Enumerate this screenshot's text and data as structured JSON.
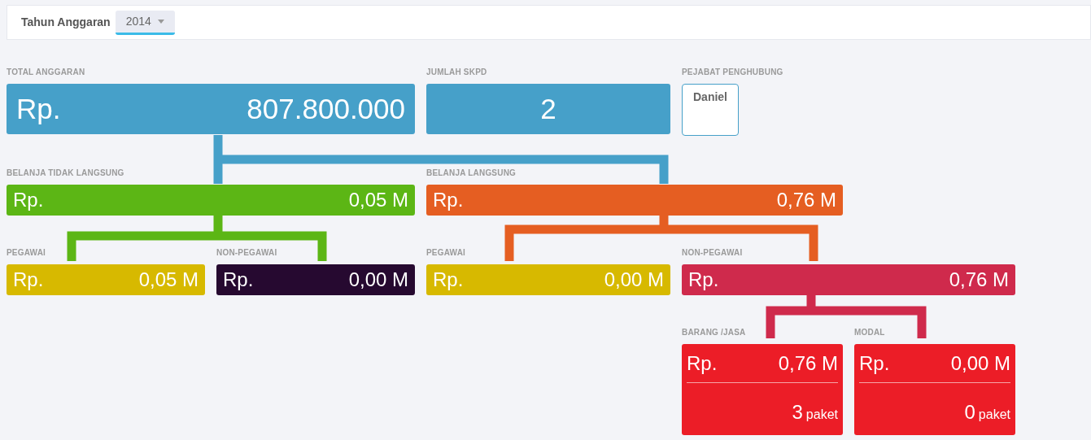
{
  "filter": {
    "label": "Tahun Anggaran",
    "year": "2014"
  },
  "nodes": [
    {
      "kind": "total",
      "label": "TOTAL ANGGARAN",
      "currency": "Rp.",
      "value": "807.800.000",
      "color": "#46a0c9"
    },
    {
      "kind": "count",
      "label": "JUMLAH SKPD",
      "value": "2",
      "color": "#46a0c9"
    },
    {
      "kind": "person",
      "label": "PEJABAT PENGHUBUNG",
      "value": "Daniel",
      "color": "#46a0c9"
    },
    {
      "kind": "amount",
      "label": "BELANJA TIDAK LANGSUNG",
      "currency": "Rp.",
      "value": "0,05 M",
      "color": "#5cb615"
    },
    {
      "kind": "amount",
      "label": "BELANJA LANGSUNG",
      "currency": "Rp.",
      "value": "0,76 M",
      "color": "#e55e22"
    },
    {
      "kind": "amount",
      "label": "PEGAWAI",
      "currency": "Rp.",
      "value": "0,05 M",
      "color": "#d7b900"
    },
    {
      "kind": "amount",
      "label": "NON-PEGAWAI",
      "currency": "Rp.",
      "value": "0,00 M",
      "color": "#260930"
    },
    {
      "kind": "amount",
      "label": "PEGAWAI",
      "currency": "Rp.",
      "value": "0,00 M",
      "color": "#d7b900"
    },
    {
      "kind": "amount",
      "label": "NON-PEGAWAI",
      "currency": "Rp.",
      "value": "0,76 M",
      "color": "#cf2a4c"
    },
    {
      "kind": "paket",
      "label": "BARANG /JASA",
      "currency": "Rp.",
      "value": "0,76 M",
      "count": "3",
      "unit": "paket",
      "color": "#ec1d27"
    },
    {
      "kind": "paket",
      "label": "MODAL",
      "currency": "Rp.",
      "value": "0,00 M",
      "count": "0",
      "unit": "paket",
      "color": "#ec1d27"
    }
  ]
}
